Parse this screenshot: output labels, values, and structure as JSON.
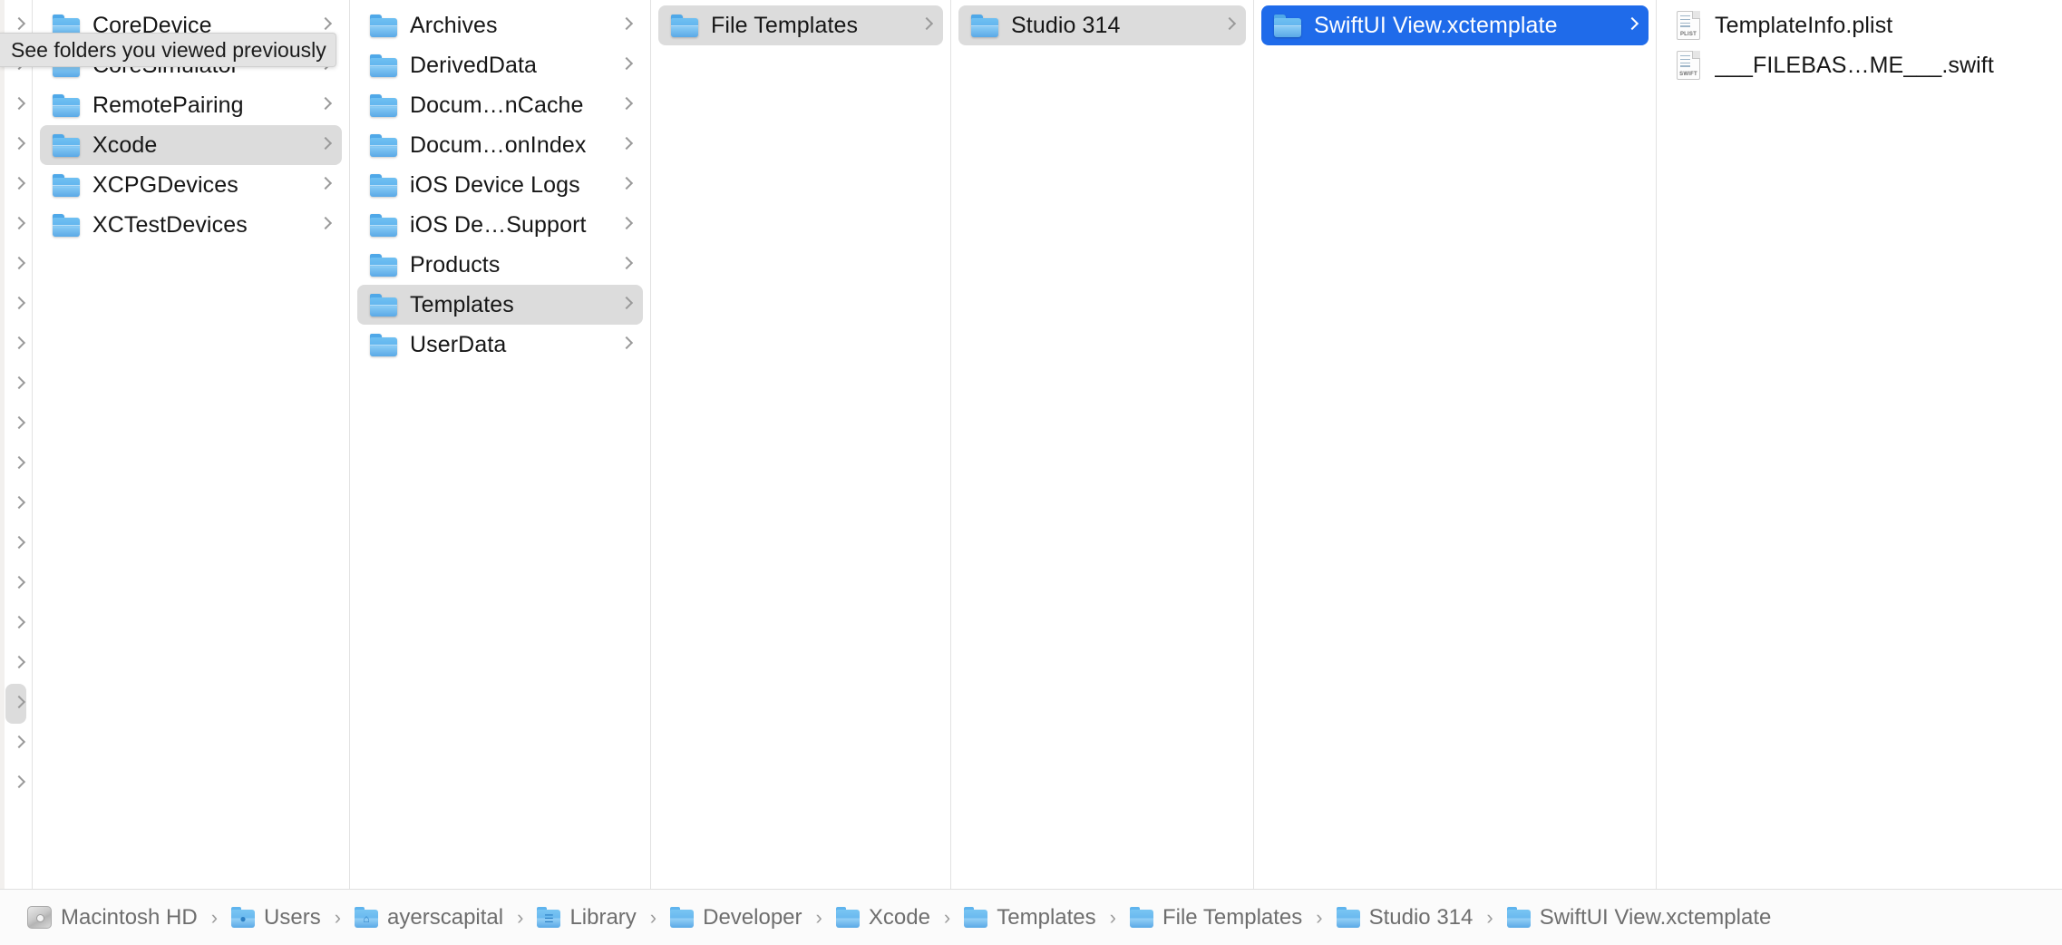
{
  "window": {
    "title": "SwiftUI View.xctemplate",
    "view_mode": "column"
  },
  "tooltip": {
    "text": "See folders you viewed previously"
  },
  "colors": {
    "selection_active": "#1f6bea",
    "selection_inactive": "#dcdcdc",
    "folder_blue": "#62b5ee",
    "text_primary": "#161616",
    "text_secondary": "#6e6e6e",
    "divider": "#e2e2e2",
    "path_bar_bg": "#fbfbfb"
  },
  "columns": [
    {
      "name": "column-stub-history",
      "items": [
        {
          "label": "",
          "icon": "",
          "chevron": true,
          "selected": "none"
        },
        {
          "label": "",
          "icon": "",
          "chevron": true,
          "selected": "none"
        },
        {
          "label": "",
          "icon": "",
          "chevron": true,
          "selected": "none"
        },
        {
          "label": "",
          "icon": "",
          "chevron": true,
          "selected": "none"
        },
        {
          "label": "",
          "icon": "",
          "chevron": true,
          "selected": "none"
        },
        {
          "label": "",
          "icon": "",
          "chevron": true,
          "selected": "none"
        },
        {
          "label": "",
          "icon": "",
          "chevron": true,
          "selected": "none"
        },
        {
          "label": "",
          "icon": "",
          "chevron": true,
          "selected": "none"
        },
        {
          "label": "",
          "icon": "",
          "chevron": true,
          "selected": "none"
        },
        {
          "label": "",
          "icon": "",
          "chevron": true,
          "selected": "none"
        },
        {
          "label": "",
          "icon": "",
          "chevron": true,
          "selected": "none"
        },
        {
          "label": "",
          "icon": "",
          "chevron": true,
          "selected": "none"
        },
        {
          "label": "",
          "icon": "",
          "chevron": true,
          "selected": "none"
        },
        {
          "label": "",
          "icon": "",
          "chevron": true,
          "selected": "none"
        },
        {
          "label": "",
          "icon": "",
          "chevron": true,
          "selected": "none"
        },
        {
          "label": "",
          "icon": "",
          "chevron": true,
          "selected": "none"
        },
        {
          "label": "",
          "icon": "",
          "chevron": true,
          "selected": "none"
        },
        {
          "label": "",
          "icon": "",
          "chevron": true,
          "selected": "grey"
        },
        {
          "label": "",
          "icon": "",
          "chevron": true,
          "selected": "none"
        },
        {
          "label": "",
          "icon": "",
          "chevron": true,
          "selected": "none"
        }
      ]
    },
    {
      "name": "column-developer",
      "items": [
        {
          "label": "CoreDevice",
          "icon": "folder-icon",
          "chevron": true,
          "selected": "none"
        },
        {
          "label": "CoreSimulator",
          "icon": "folder-icon",
          "chevron": true,
          "selected": "none"
        },
        {
          "label": "RemotePairing",
          "icon": "folder-icon",
          "chevron": true,
          "selected": "none"
        },
        {
          "label": "Xcode",
          "icon": "folder-icon",
          "chevron": true,
          "selected": "grey"
        },
        {
          "label": "XCPGDevices",
          "icon": "folder-icon",
          "chevron": true,
          "selected": "none"
        },
        {
          "label": "XCTestDevices",
          "icon": "folder-icon",
          "chevron": true,
          "selected": "none"
        }
      ]
    },
    {
      "name": "column-xcode",
      "items": [
        {
          "label": "Archives",
          "icon": "folder-icon",
          "chevron": true,
          "selected": "none"
        },
        {
          "label": "DerivedData",
          "icon": "folder-icon",
          "chevron": true,
          "selected": "none"
        },
        {
          "label": "Docum…nCache",
          "icon": "folder-icon",
          "chevron": true,
          "selected": "none"
        },
        {
          "label": "Docum…onIndex",
          "icon": "folder-icon",
          "chevron": true,
          "selected": "none"
        },
        {
          "label": "iOS Device Logs",
          "icon": "folder-icon",
          "chevron": true,
          "selected": "none"
        },
        {
          "label": "iOS De…Support",
          "icon": "folder-icon",
          "chevron": true,
          "selected": "none"
        },
        {
          "label": "Products",
          "icon": "folder-icon",
          "chevron": true,
          "selected": "none"
        },
        {
          "label": "Templates",
          "icon": "folder-icon",
          "chevron": true,
          "selected": "grey"
        },
        {
          "label": "UserData",
          "icon": "folder-icon",
          "chevron": true,
          "selected": "none"
        }
      ]
    },
    {
      "name": "column-templates",
      "items": [
        {
          "label": "File Templates",
          "icon": "folder-icon",
          "chevron": true,
          "selected": "grey"
        }
      ]
    },
    {
      "name": "column-file-templates",
      "items": [
        {
          "label": "Studio 314",
          "icon": "folder-icon",
          "chevron": true,
          "selected": "grey"
        }
      ]
    },
    {
      "name": "column-studio-314",
      "items": [
        {
          "label": "SwiftUI View.xctemplate",
          "icon": "folder-icon",
          "chevron": true,
          "selected": "blue"
        }
      ]
    },
    {
      "name": "column-xctemplate-contents",
      "items": [
        {
          "label": "TemplateInfo.plist",
          "icon": "plist-file-icon",
          "kind": "PLIST",
          "chevron": false,
          "selected": "none"
        },
        {
          "label": "___FILEBAS…ME___.swift",
          "icon": "swift-file-icon",
          "kind": "SWIFT",
          "chevron": false,
          "selected": "none"
        }
      ]
    }
  ],
  "path_bar": {
    "name": "breadcrumb-path-bar",
    "crumbs": [
      {
        "label": "Macintosh HD",
        "icon": "hard-disk-icon"
      },
      {
        "label": "Users",
        "icon": "users-folder-icon",
        "glyph": "●"
      },
      {
        "label": "ayerscapital",
        "icon": "home-folder-icon",
        "glyph": "⌂"
      },
      {
        "label": "Library",
        "icon": "library-folder-icon",
        "glyph": "☰"
      },
      {
        "label": "Developer",
        "icon": "folder-icon",
        "glyph": ""
      },
      {
        "label": "Xcode",
        "icon": "folder-icon",
        "glyph": ""
      },
      {
        "label": "Templates",
        "icon": "folder-icon",
        "glyph": ""
      },
      {
        "label": "File Templates",
        "icon": "folder-icon",
        "glyph": ""
      },
      {
        "label": "Studio 314",
        "icon": "folder-icon",
        "glyph": ""
      },
      {
        "label": "SwiftUI View.xctemplate",
        "icon": "folder-icon",
        "glyph": ""
      }
    ],
    "separator": "›"
  }
}
